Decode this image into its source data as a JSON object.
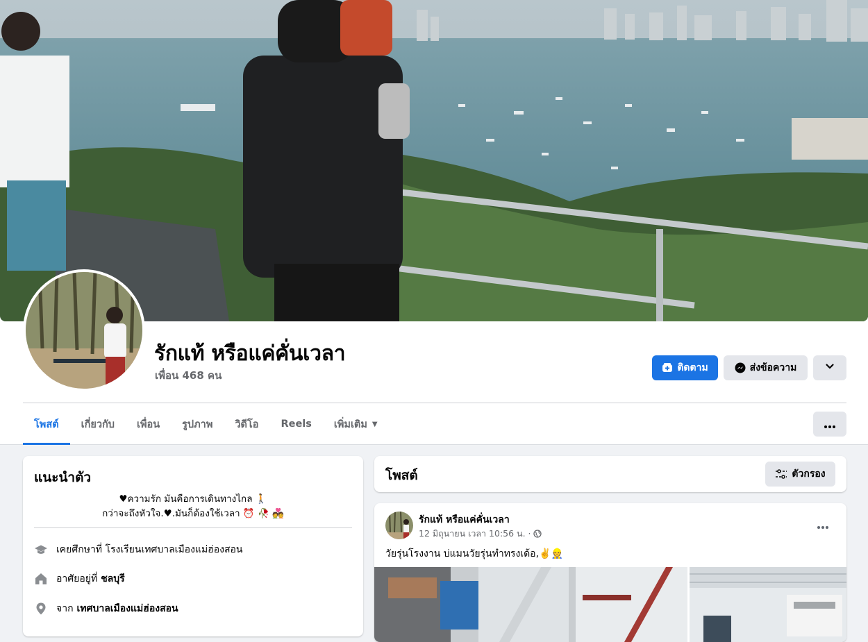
{
  "profile": {
    "name": "รักแท้ หรือแค่คั่นเวลา",
    "friends": "เพื่อน 468 คน"
  },
  "actions": {
    "follow_label": "ติดตาม",
    "message_label": "ส่งข้อความ"
  },
  "tabs": [
    {
      "label": "โพสต์",
      "active": true
    },
    {
      "label": "เกี่ยวกับ",
      "active": false
    },
    {
      "label": "เพื่อน",
      "active": false
    },
    {
      "label": "รูปภาพ",
      "active": false
    },
    {
      "label": "วิดีโอ",
      "active": false
    },
    {
      "label": "Reels",
      "active": false
    },
    {
      "label": "เพิ่มเติม",
      "active": false
    }
  ],
  "intro": {
    "title": "แนะนำตัว",
    "bio_line1": "♥ความรัก มันคือการเดินทางไกล 🚶",
    "bio_line2": "กว่าจะถึงหัวใจ.♥.มันก็ต้องใช้เวลา ⏰ 🥀 💑",
    "studied_prefix": "เคยศึกษาที่ โรงเรียนเทศบาลเมืองแม่ฮ่องสอน",
    "lives_prefix": "อาศัยอยู่ที่",
    "lives_place": "ชลบุรี",
    "from_prefix": "จาก",
    "from_place": "เทศบาลเมืองแม่ฮ่องสอน"
  },
  "posts_section": {
    "title": "โพสต์",
    "filter_label": "ตัวกรอง"
  },
  "post": {
    "author": "รักแท้ หรือแค่คั่นเวลา",
    "time": "12 มิถุนายน เวลา 10:56 น. ·",
    "text": "วัยรุ่นโรงงาน  บ่แมนวัยรุ่นทำทรงเด้อ,✌️👷"
  },
  "colors": {
    "accent": "#1b74e4",
    "page_bg": "#f0f2f5",
    "secondary_text": "#65676b"
  },
  "icons": [
    "follow-plus-icon",
    "messenger-icon",
    "chevron-down-icon",
    "more-dots-icon",
    "graduation-cap-icon",
    "home-icon",
    "location-pin-icon",
    "filter-icon",
    "globe-icon"
  ]
}
